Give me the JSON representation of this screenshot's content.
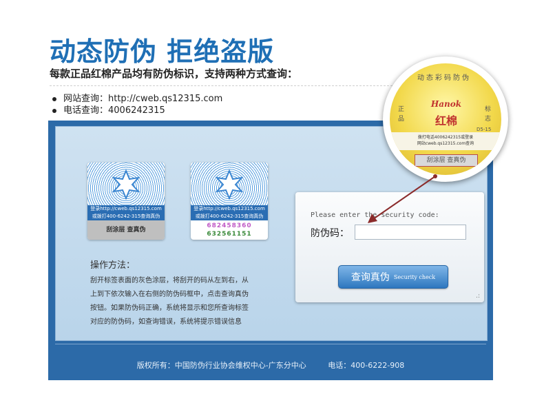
{
  "header": {
    "title": "动态防伪 拒绝盗版",
    "subtitle": "每款正品红棉产品均有防伪标识，支持两种方式查询："
  },
  "info": {
    "website": "网站查询：http://cweb.qs12315.com",
    "phone": "电话查询：4006242315"
  },
  "labels": {
    "left": {
      "line1": "登录http://cweb.qs12315.com",
      "line2": "或拨打400-6242-315查询真伪",
      "scratch": "刮涂层 查真伪"
    },
    "right": {
      "line1": "登录http://cweb.qs12315.com",
      "line2": "或拨打400-6242-315查询真伪",
      "code_line1": "682458360",
      "code_line2": "632561151"
    }
  },
  "howto": {
    "title": "操作方法：",
    "lines": [
      "刮开标签表面的灰色涂层，将刮开的码从左到右，从",
      "上到下依次输入在右侧的防伪码框中，点击查询真伪",
      "按钮。如果防伪码正确，系统将显示和您所查询标签",
      "对应的防伪码，如查询错误，系统将提示错误信息"
    ]
  },
  "form": {
    "prompt": "Please enter the security code:",
    "code_label": "防伪码：",
    "code_value": "",
    "button_cn": "查询真伪",
    "button_en": "Security check",
    "resize_glyph": ".:"
  },
  "footer": {
    "copyright": "版权所有：中国防伪行业协会维权中心-广东分中心",
    "phone": "电话：400-6222-908"
  },
  "seal": {
    "ring_text": "动态彩码防伪",
    "left_text": "正品",
    "right_text": "标志",
    "logo": "Hanok",
    "brand": "红棉",
    "model": "D5-15",
    "line1": "拨打电话4006242315或登录",
    "line2": "网站cweb.qs12315.com查询",
    "scratch": "刮涂层 查真伪"
  },
  "colors": {
    "title": "#1f6fb5",
    "panel": "#2c6aa8",
    "accent_arrow": "#8b2b2b"
  },
  "icons": [
    "star-icon",
    "bullet-icon",
    "arrow-icon"
  ]
}
